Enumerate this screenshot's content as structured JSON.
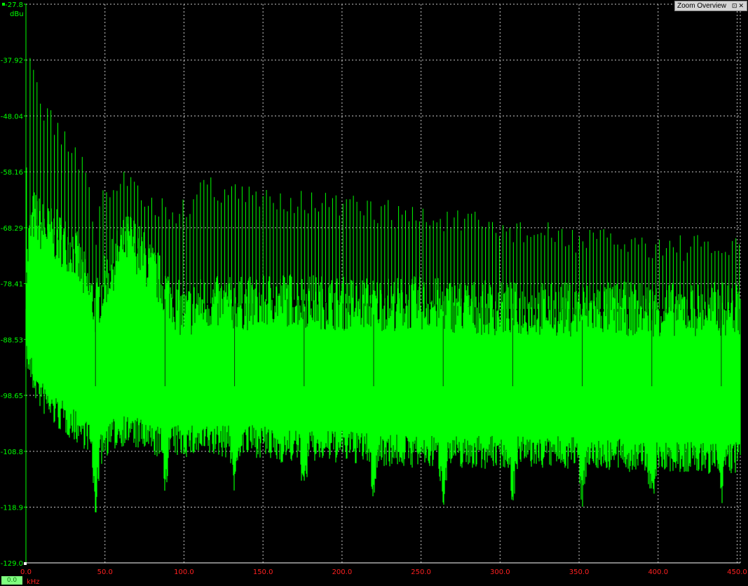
{
  "zoom_overview": {
    "title": "Zoom Overview",
    "pin_icon": "pin-icon",
    "close_icon": "close-icon"
  },
  "cursor_readout": "0.0",
  "colors": {
    "background": "#000000",
    "trace": "#00ff00",
    "grid": "#cccccc",
    "x_labels": "#ff2020",
    "y_labels": "#00ff00"
  },
  "chart_data": {
    "type": "line",
    "title": "",
    "xlabel": "kHz",
    "ylabel": "dBu",
    "xlim": [
      0,
      452
    ],
    "ylim": [
      -129.0,
      -27.8
    ],
    "grid": true,
    "legend": "none",
    "y_ticks": [
      "-27.8",
      "-37.92",
      "-48.04",
      "-58.16",
      "-68.29",
      "-78.41",
      "-88.53",
      "-98.65",
      "-108.8",
      "-118.9",
      "-129.0"
    ],
    "x_ticks": [
      "0.0",
      "50.0",
      "100.0",
      "150.0",
      "200.0",
      "250.0",
      "300.0",
      "350.0",
      "400.0",
      "450.0"
    ],
    "series": [
      {
        "harmonic_spacing_khz": 2.2,
        "dip_spacing_khz": 44,
        "envelope_x": [
          0,
          2,
          5,
          10,
          20,
          30,
          40,
          44,
          50,
          60,
          66,
          80,
          100,
          110,
          150,
          155,
          200,
          250,
          300,
          350,
          400,
          450
        ],
        "peak_envelope": [
          -62,
          -36,
          -38,
          -44,
          -48,
          -52,
          -58,
          -67,
          -60,
          -58,
          -56,
          -62,
          -63,
          -58,
          -61,
          -60,
          -62,
          -64,
          -66,
          -68,
          -69,
          -70
        ],
        "noise_top": [
          -78,
          -70,
          -66,
          -68,
          -70,
          -72,
          -80,
          -83,
          -78,
          -72,
          -70,
          -76,
          -84,
          -82,
          -82,
          -81,
          -82,
          -82,
          -83,
          -83,
          -83,
          -83
        ],
        "noise_bottom": [
          -88,
          -90,
          -93,
          -96,
          -99,
          -101,
          -103,
          -108,
          -104,
          -102,
          -102,
          -104,
          -104,
          -104,
          -104,
          -105,
          -105,
          -106,
          -106,
          -106,
          -107,
          -107
        ]
      }
    ]
  }
}
